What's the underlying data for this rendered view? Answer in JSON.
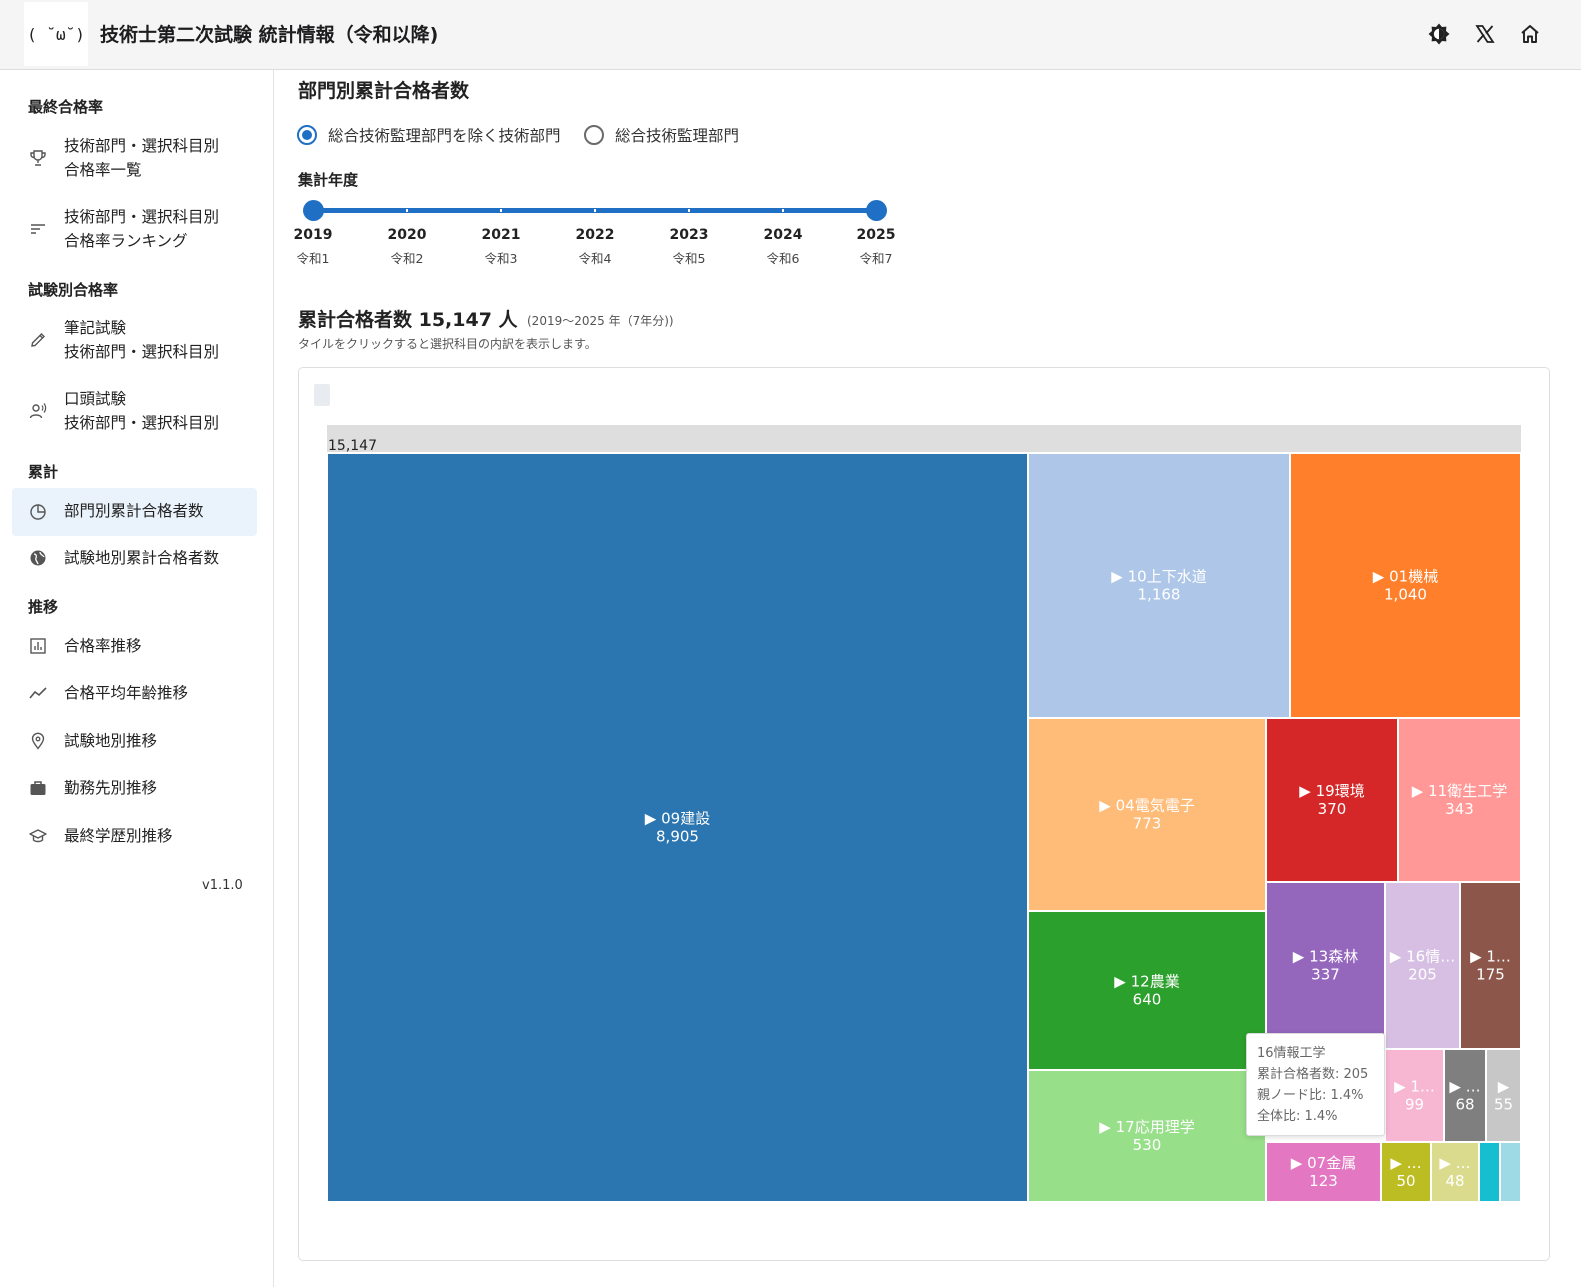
{
  "header": {
    "logo_text": "( ˘ω˘)",
    "title": "技術士第二次試験 統計情報（令和以降)",
    "icons": [
      "brightness-icon",
      "x-icon",
      "home-icon"
    ]
  },
  "sidebar": {
    "sections": [
      {
        "title": "最終合格率"
      },
      {
        "title": "試験別合格率"
      },
      {
        "title": "累計"
      },
      {
        "title": "推移"
      }
    ],
    "items": [
      {
        "line1": "技術部門・選択科目別",
        "line2": "合格率一覧",
        "icon": "trophy-icon"
      },
      {
        "line1": "技術部門・選択科目別",
        "line2": "合格率ランキング",
        "icon": "sort-icon"
      },
      {
        "line1": "筆記試験",
        "line2": "技術部門・選択科目別",
        "icon": "pencil-icon"
      },
      {
        "line1": "口頭試験",
        "line2": "技術部門・選択科目別",
        "icon": "speaker-icon"
      },
      {
        "line1": "部門別累計合格者数",
        "icon": "pie-chart-icon",
        "active": true
      },
      {
        "line1": "試験地別累計合格者数",
        "icon": "globe-icon"
      },
      {
        "line1": "合格率推移",
        "icon": "bar-chart-icon"
      },
      {
        "line1": "合格平均年齢推移",
        "icon": "trend-icon"
      },
      {
        "line1": "試験地別推移",
        "icon": "location-pin-icon"
      },
      {
        "line1": "勤務先別推移",
        "icon": "briefcase-icon"
      },
      {
        "line1": "最終学歴別推移",
        "icon": "graduation-cap-icon"
      }
    ],
    "version": "v1.1.0"
  },
  "main": {
    "title": "部門別累計合格者数",
    "radio": {
      "options": [
        "総合技術監理部門を除く技術部門",
        "総合技術監理部門"
      ],
      "selected": 0
    },
    "year_filter": {
      "label": "集計年度",
      "ticks": [
        {
          "year": "2019",
          "era": "令和1"
        },
        {
          "year": "2020",
          "era": "令和2"
        },
        {
          "year": "2021",
          "era": "令和3"
        },
        {
          "year": "2022",
          "era": "令和4"
        },
        {
          "year": "2023",
          "era": "令和5"
        },
        {
          "year": "2024",
          "era": "令和6"
        },
        {
          "year": "2025",
          "era": "令和7"
        }
      ],
      "range": [
        "2019",
        "2025"
      ]
    },
    "total": "累計合格者数 15,147 人",
    "total_range": "(2019〜2025 年（7年分))",
    "hint": "タイルをクリックすると選択科目の内訳を表示します。"
  },
  "chart_data": {
    "type": "treemap",
    "root_label": "15,147",
    "root_value": 15147,
    "series": [
      {
        "name": "09建設",
        "label": "▶ 09建設",
        "value": 8905,
        "color": "#2b76b1"
      },
      {
        "name": "10上下水道",
        "label": "▶ 10上下水道",
        "value": 1168,
        "color": "#aec7e8"
      },
      {
        "name": "01機械",
        "label": "▶ 01機械",
        "value": 1040,
        "color": "#ff7f2a"
      },
      {
        "name": "04電気電子",
        "label": "▶ 04電気電子",
        "value": 773,
        "color": "#ffbb78"
      },
      {
        "name": "19環境",
        "label": "▶ 19環境",
        "value": 370,
        "color": "#d62728"
      },
      {
        "name": "11衛生工学",
        "label": "▶ 11衛生工学",
        "value": 343,
        "color": "#ff9896"
      },
      {
        "name": "12農業",
        "label": "▶ 12農業",
        "value": 640,
        "color": "#2ca02c"
      },
      {
        "name": "13森林",
        "label": "▶ 13森林",
        "value": 337,
        "color": "#9467bd"
      },
      {
        "name": "16情報工学",
        "label": "▶ 16情…",
        "value": 205,
        "color": "#d6bfe3"
      },
      {
        "name": "",
        "label": "▶ 1…",
        "value": 175,
        "color": "#8c564b"
      },
      {
        "name": "17応用理学",
        "label": "▶ 17応用理学",
        "value": 530,
        "color": "#98df8a"
      },
      {
        "name": "",
        "label": "▶ 1…",
        "value": 99,
        "color": "#f7b6d2"
      },
      {
        "name": "",
        "label": "▶ …",
        "value": 68,
        "color": "#7f7f7f"
      },
      {
        "name": "",
        "label": "▶",
        "value": 55,
        "color": "#c7c7c7"
      },
      {
        "name": "07金属",
        "label": "▶ 07金属",
        "value": 123,
        "color": "#e377c2"
      },
      {
        "name": "",
        "label": "▶ …",
        "value": 50,
        "color": "#bcbd22"
      },
      {
        "name": "",
        "label": "▶ …",
        "value": 48,
        "color": "#dbdb8d"
      },
      {
        "name": "",
        "label": "",
        "value": null,
        "color": "#17becf"
      },
      {
        "name": "",
        "label": "",
        "value": null,
        "color": "#9edae5"
      }
    ],
    "tooltip": {
      "title": "16情報工学",
      "line1": "累計合格者数: 205",
      "line2": "親ノード比: 1.4%",
      "line3": "全体比: 1.4%"
    }
  }
}
